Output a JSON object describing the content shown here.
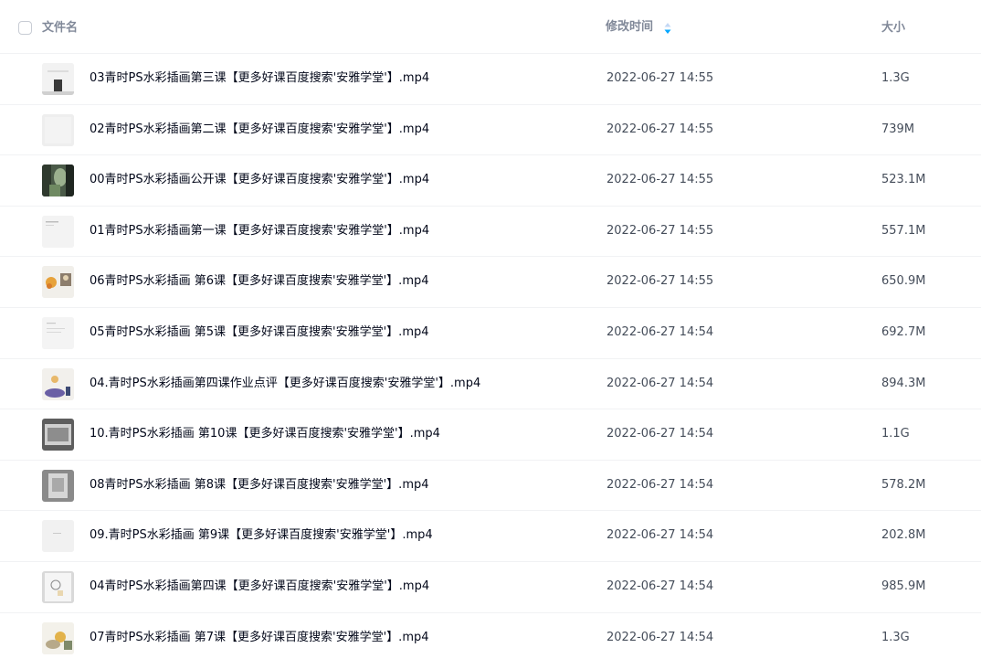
{
  "header": {
    "name_label": "文件名",
    "time_label": "修改时间",
    "size_label": "大小"
  },
  "files": [
    {
      "name": "03青时PS水彩插画第三课【更多好课百度搜索'安雅学堂'】.mp4",
      "time": "2022-06-27 14:55",
      "size": "1.3G"
    },
    {
      "name": "02青时PS水彩插画第二课【更多好课百度搜索'安雅学堂'】.mp4",
      "time": "2022-06-27 14:55",
      "size": "739M"
    },
    {
      "name": "00青时PS水彩插画公开课【更多好课百度搜索'安雅学堂'】.mp4",
      "time": "2022-06-27 14:55",
      "size": "523.1M"
    },
    {
      "name": "01青时PS水彩插画第一课【更多好课百度搜索'安雅学堂'】.mp4",
      "time": "2022-06-27 14:55",
      "size": "557.1M"
    },
    {
      "name": "06青时PS水彩插画 第6课【更多好课百度搜索'安雅学堂'】.mp4",
      "time": "2022-06-27 14:55",
      "size": "650.9M"
    },
    {
      "name": "05青时PS水彩插画 第5课【更多好课百度搜索'安雅学堂'】.mp4",
      "time": "2022-06-27 14:54",
      "size": "692.7M"
    },
    {
      "name": "04.青时PS水彩插画第四课作业点评【更多好课百度搜索'安雅学堂'】.mp4",
      "time": "2022-06-27 14:54",
      "size": "894.3M"
    },
    {
      "name": "10.青时PS水彩插画 第10课【更多好课百度搜索'安雅学堂'】.mp4",
      "time": "2022-06-27 14:54",
      "size": "1.1G"
    },
    {
      "name": "08青时PS水彩插画 第8课【更多好课百度搜索'安雅学堂'】.mp4",
      "time": "2022-06-27 14:54",
      "size": "578.2M"
    },
    {
      "name": "09.青时PS水彩插画 第9课【更多好课百度搜索'安雅学堂'】.mp4",
      "time": "2022-06-27 14:54",
      "size": "202.8M"
    },
    {
      "name": "04青时PS水彩插画第四课【更多好课百度搜索'安雅学堂'】.mp4",
      "time": "2022-06-27 14:54",
      "size": "985.9M"
    },
    {
      "name": "07青时PS水彩插画 第7课【更多好课百度搜索'安雅学堂'】.mp4",
      "time": "2022-06-27 14:54",
      "size": "1.3G"
    }
  ],
  "colors": {
    "sort_active": "#06a7ff",
    "sort_inactive": "#c4d8f4"
  }
}
